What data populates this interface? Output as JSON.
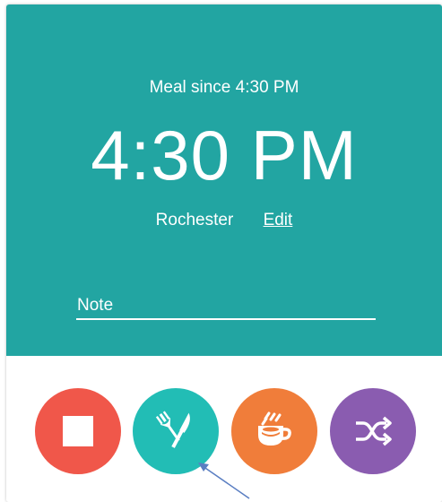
{
  "status": {
    "since_label": "Meal since 4:30 PM",
    "clock": "4:30 PM",
    "location": "Rochester",
    "edit_label": "Edit",
    "note_placeholder": "Note"
  },
  "actions": [
    {
      "name": "stop",
      "icon": "stop-icon",
      "color": "#f0574a"
    },
    {
      "name": "meal",
      "icon": "fork-knife-icon",
      "color": "#22bdb5"
    },
    {
      "name": "coffee",
      "icon": "coffee-cup-icon",
      "color": "#f07d3a"
    },
    {
      "name": "shuffle",
      "icon": "shuffle-icon",
      "color": "#8a5cb0"
    }
  ],
  "colors": {
    "panel": "#22a5a2",
    "annotation_arrow": "#5a7ec2"
  }
}
